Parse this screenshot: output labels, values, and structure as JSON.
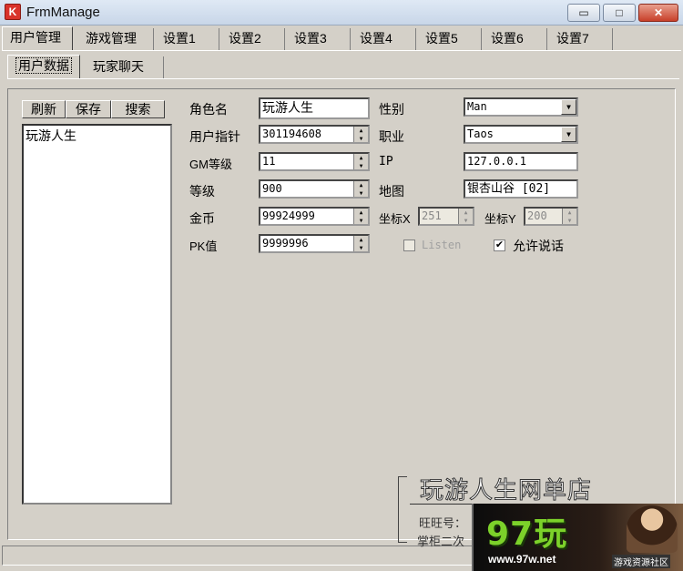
{
  "window": {
    "title": "FrmManage",
    "min": "▭",
    "max": "□",
    "close": "✕"
  },
  "tabs": [
    "用户管理",
    "游戏管理",
    "设置1",
    "设置2",
    "设置3",
    "设置4",
    "设置5",
    "设置6",
    "设置7"
  ],
  "subtabs": [
    "用户数据",
    "玩家聊天"
  ],
  "buttons": {
    "refresh": "刷新",
    "save": "保存",
    "search": "搜索"
  },
  "list": [
    "玩游人生"
  ],
  "form": {
    "role_name": {
      "label": "角色名",
      "value": "玩游人生"
    },
    "user_ptr": {
      "label": "用户指针",
      "value": "301194608"
    },
    "gm_level": {
      "label": "GM等级",
      "value": "11"
    },
    "level": {
      "label": "等级",
      "value": "900"
    },
    "gold": {
      "label": "金币",
      "value": "99924999"
    },
    "pk": {
      "label": "PK值",
      "value": "9999996"
    },
    "gender": {
      "label": "性别",
      "value": "Man"
    },
    "job": {
      "label": "职业",
      "value": "Taos"
    },
    "ip": {
      "label": "IP",
      "value": "127.0.0.1"
    },
    "map": {
      "label": "地图",
      "value": "银杏山谷 [02]"
    },
    "coord_x": {
      "label": "坐标X",
      "value": "251"
    },
    "coord_y": {
      "label": "坐标Y",
      "value": "200"
    },
    "listen": {
      "label": "Listen",
      "checked": false,
      "enabled": false
    },
    "allow_talk": {
      "label": "允许说话",
      "checked": true
    }
  },
  "watermark": {
    "shop": "玩游人生网单店",
    "wangwang": "旺旺号：",
    "seller": "掌柜二次",
    "logo": "97玩",
    "url": "www.97w.net",
    "community": "游戏资源社区"
  }
}
